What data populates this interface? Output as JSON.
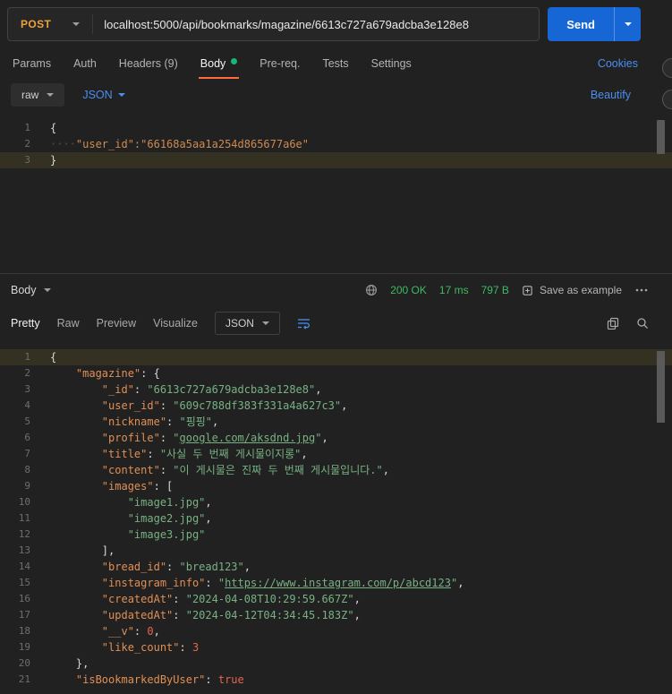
{
  "colors": {
    "accent_orange": "#ff6c37",
    "method_post_yellow": "#eda13c",
    "send_button_blue": "#1766d6",
    "link_blue": "#4a8ff0",
    "status_green": "#3dba64",
    "json_key_orange": "#e08f55",
    "json_string_green": "#78b183",
    "json_number_red": "#e2674d",
    "line_highlight": "#343122",
    "unsaved_dot_green": "#17b877"
  },
  "icons": {
    "method_dropdown": "chevron-down",
    "send_options": "chevron-down",
    "body_type_dropdown": "chevron-down",
    "format_dropdown": "chevron-down",
    "network_status": "globe",
    "save_example": "bookmark",
    "more_options": "ellipsis",
    "copy": "copy",
    "search": "magnifier",
    "text_wrap": "wrap-lines"
  },
  "request": {
    "method": "POST",
    "url": "localhost:5000/api/bookmarks/magazine/6613c727a679adcba3e128e8",
    "send_label": "Send",
    "cookies_link": "Cookies",
    "tabs": [
      {
        "label": "Params"
      },
      {
        "label": "Auth"
      },
      {
        "label": "Headers (9)"
      },
      {
        "label": "Body",
        "active": true,
        "dot": true
      },
      {
        "label": "Pre-req."
      },
      {
        "label": "Tests"
      },
      {
        "label": "Settings"
      }
    ],
    "body_type_label": "raw",
    "body_format_label": "JSON",
    "beautify_label": "Beautify",
    "editor": {
      "lines": [
        {
          "num": "1",
          "segments": [
            {
              "text": "{",
              "type": "plain"
            }
          ]
        },
        {
          "num": "2",
          "segments": [
            {
              "text": "····",
              "type": "ws"
            },
            {
              "text": "\"user_id\":\"66168a5aa1a254d865677a6e\"",
              "type": "rawstr"
            }
          ]
        },
        {
          "num": "3",
          "highlight": true,
          "segments": [
            {
              "text": "}",
              "type": "plain"
            }
          ]
        }
      ]
    }
  },
  "response": {
    "body_label": "Body",
    "status": "200 OK",
    "time": "17 ms",
    "size": "797 B",
    "save_example_label": "Save as example",
    "view_tabs": [
      {
        "label": "Pretty",
        "active": true
      },
      {
        "label": "Raw"
      },
      {
        "label": "Preview"
      },
      {
        "label": "Visualize"
      }
    ],
    "format_label": "JSON",
    "editor": {
      "lines": [
        {
          "num": "1",
          "highlight": true,
          "segments": [
            {
              "text": "{",
              "type": "plain"
            }
          ]
        },
        {
          "num": "2",
          "segments": [
            {
              "text": "    ",
              "type": "plain"
            },
            {
              "text": "\"magazine\"",
              "type": "key"
            },
            {
              "text": ": {",
              "type": "plain"
            }
          ]
        },
        {
          "num": "3",
          "segments": [
            {
              "text": "        ",
              "type": "plain"
            },
            {
              "text": "\"_id\"",
              "type": "key"
            },
            {
              "text": ": ",
              "type": "plain"
            },
            {
              "text": "\"6613c727a679adcba3e128e8\"",
              "type": "str"
            },
            {
              "text": ",",
              "type": "plain"
            }
          ]
        },
        {
          "num": "4",
          "segments": [
            {
              "text": "        ",
              "type": "plain"
            },
            {
              "text": "\"user_id\"",
              "type": "key"
            },
            {
              "text": ": ",
              "type": "plain"
            },
            {
              "text": "\"609c788df383f331a4a627c3\"",
              "type": "str"
            },
            {
              "text": ",",
              "type": "plain"
            }
          ]
        },
        {
          "num": "5",
          "segments": [
            {
              "text": "        ",
              "type": "plain"
            },
            {
              "text": "\"nickname\"",
              "type": "key"
            },
            {
              "text": ": ",
              "type": "plain"
            },
            {
              "text": "\"핑핑\"",
              "type": "str"
            },
            {
              "text": ",",
              "type": "plain"
            }
          ]
        },
        {
          "num": "6",
          "segments": [
            {
              "text": "        ",
              "type": "plain"
            },
            {
              "text": "\"profile\"",
              "type": "key"
            },
            {
              "text": ": ",
              "type": "plain"
            },
            {
              "text": "\"",
              "type": "str"
            },
            {
              "text": "google.com/aksdnd.jpg",
              "type": "link"
            },
            {
              "text": "\"",
              "type": "str"
            },
            {
              "text": ",",
              "type": "plain"
            }
          ]
        },
        {
          "num": "7",
          "segments": [
            {
              "text": "        ",
              "type": "plain"
            },
            {
              "text": "\"title\"",
              "type": "key"
            },
            {
              "text": ": ",
              "type": "plain"
            },
            {
              "text": "\"사실 두 번째 게시물이지롱\"",
              "type": "str"
            },
            {
              "text": ",",
              "type": "plain"
            }
          ]
        },
        {
          "num": "8",
          "segments": [
            {
              "text": "        ",
              "type": "plain"
            },
            {
              "text": "\"content\"",
              "type": "key"
            },
            {
              "text": ": ",
              "type": "plain"
            },
            {
              "text": "\"이 게시물은 진짜 두 번째 게시물입니다.\"",
              "type": "str"
            },
            {
              "text": ",",
              "type": "plain"
            }
          ]
        },
        {
          "num": "9",
          "segments": [
            {
              "text": "        ",
              "type": "plain"
            },
            {
              "text": "\"images\"",
              "type": "key"
            },
            {
              "text": ": [",
              "type": "plain"
            }
          ]
        },
        {
          "num": "10",
          "segments": [
            {
              "text": "            ",
              "type": "plain"
            },
            {
              "text": "\"image1.jpg\"",
              "type": "str"
            },
            {
              "text": ",",
              "type": "plain"
            }
          ]
        },
        {
          "num": "11",
          "segments": [
            {
              "text": "            ",
              "type": "plain"
            },
            {
              "text": "\"image2.jpg\"",
              "type": "str"
            },
            {
              "text": ",",
              "type": "plain"
            }
          ]
        },
        {
          "num": "12",
          "segments": [
            {
              "text": "            ",
              "type": "plain"
            },
            {
              "text": "\"image3.jpg\"",
              "type": "str"
            }
          ]
        },
        {
          "num": "13",
          "segments": [
            {
              "text": "        ],",
              "type": "plain"
            }
          ]
        },
        {
          "num": "14",
          "segments": [
            {
              "text": "        ",
              "type": "plain"
            },
            {
              "text": "\"bread_id\"",
              "type": "key"
            },
            {
              "text": ": ",
              "type": "plain"
            },
            {
              "text": "\"bread123\"",
              "type": "str"
            },
            {
              "text": ",",
              "type": "plain"
            }
          ]
        },
        {
          "num": "15",
          "segments": [
            {
              "text": "        ",
              "type": "plain"
            },
            {
              "text": "\"instagram_info\"",
              "type": "key"
            },
            {
              "text": ": ",
              "type": "plain"
            },
            {
              "text": "\"",
              "type": "str"
            },
            {
              "text": "https://www.instagram.com/p/abcd123",
              "type": "link"
            },
            {
              "text": "\"",
              "type": "str"
            },
            {
              "text": ",",
              "type": "plain"
            }
          ]
        },
        {
          "num": "16",
          "segments": [
            {
              "text": "        ",
              "type": "plain"
            },
            {
              "text": "\"createdAt\"",
              "type": "key"
            },
            {
              "text": ": ",
              "type": "plain"
            },
            {
              "text": "\"2024-04-08T10:29:59.667Z\"",
              "type": "str"
            },
            {
              "text": ",",
              "type": "plain"
            }
          ]
        },
        {
          "num": "17",
          "segments": [
            {
              "text": "        ",
              "type": "plain"
            },
            {
              "text": "\"updatedAt\"",
              "type": "key"
            },
            {
              "text": ": ",
              "type": "plain"
            },
            {
              "text": "\"2024-04-12T04:34:45.183Z\"",
              "type": "str"
            },
            {
              "text": ",",
              "type": "plain"
            }
          ]
        },
        {
          "num": "18",
          "segments": [
            {
              "text": "        ",
              "type": "plain"
            },
            {
              "text": "\"__v\"",
              "type": "key"
            },
            {
              "text": ": ",
              "type": "plain"
            },
            {
              "text": "0",
              "type": "num"
            },
            {
              "text": ",",
              "type": "plain"
            }
          ]
        },
        {
          "num": "19",
          "segments": [
            {
              "text": "        ",
              "type": "plain"
            },
            {
              "text": "\"like_count\"",
              "type": "key"
            },
            {
              "text": ": ",
              "type": "plain"
            },
            {
              "text": "3",
              "type": "num"
            }
          ]
        },
        {
          "num": "20",
          "segments": [
            {
              "text": "    },",
              "type": "plain"
            }
          ]
        },
        {
          "num": "21",
          "segments": [
            {
              "text": "    ",
              "type": "plain"
            },
            {
              "text": "\"isBookmarkedByUser\"",
              "type": "key"
            },
            {
              "text": ": ",
              "type": "plain"
            },
            {
              "text": "true",
              "type": "bool"
            }
          ]
        }
      ]
    }
  }
}
